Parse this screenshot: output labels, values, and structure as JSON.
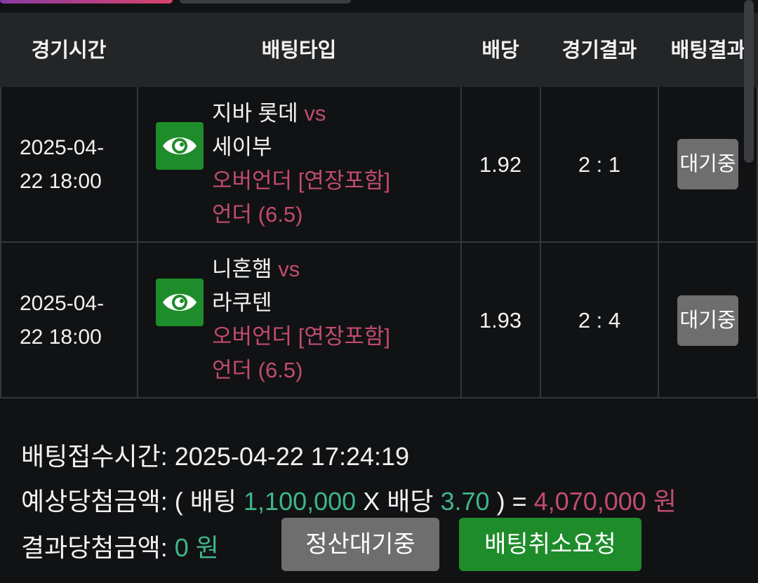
{
  "header": {
    "time": "경기시간",
    "type": "배팅타입",
    "odds": "배당",
    "score": "경기결과",
    "result": "배팅결과"
  },
  "rows": [
    {
      "time_line1": "2025-04-",
      "time_line2": "22 18:00",
      "home": "지바 롯데",
      "vs": "vs",
      "away": "세이부",
      "market": "오버언더 [연장포함]",
      "pick": "언더 (6.5)",
      "odds": "1.92",
      "score": "2 : 1",
      "status": "대기중"
    },
    {
      "time_line1": "2025-04-",
      "time_line2": "22 18:00",
      "home": "니혼햄",
      "vs": "vs",
      "away": "라쿠텐",
      "market": "오버언더 [연장포함]",
      "pick": "언더 (6.5)",
      "odds": "1.93",
      "score": "2 : 4",
      "status": "대기중"
    }
  ],
  "summary": {
    "received_label": "배팅접수시간:",
    "received_value": "2025-04-22 17:24:19",
    "expected_label": "예상당첨금액:",
    "open_paren": "(",
    "bet_word": "배팅",
    "bet_amount": "1,100,000",
    "times": "X",
    "odds_word": "배당",
    "total_odds": "3.70",
    "close_paren": ")",
    "equals": "=",
    "payout": "4,070,000 원",
    "result_label": "결과당첨금액:",
    "result_value": "0 원"
  },
  "buttons": {
    "settle_wait": "정산대기중",
    "cancel_request": "배팅취소요청"
  },
  "colors": {
    "accent_pink": "#c24b73",
    "accent_green": "#3fb58e",
    "button_green": "#1e8c2a",
    "button_gray": "#6e6e6e"
  }
}
